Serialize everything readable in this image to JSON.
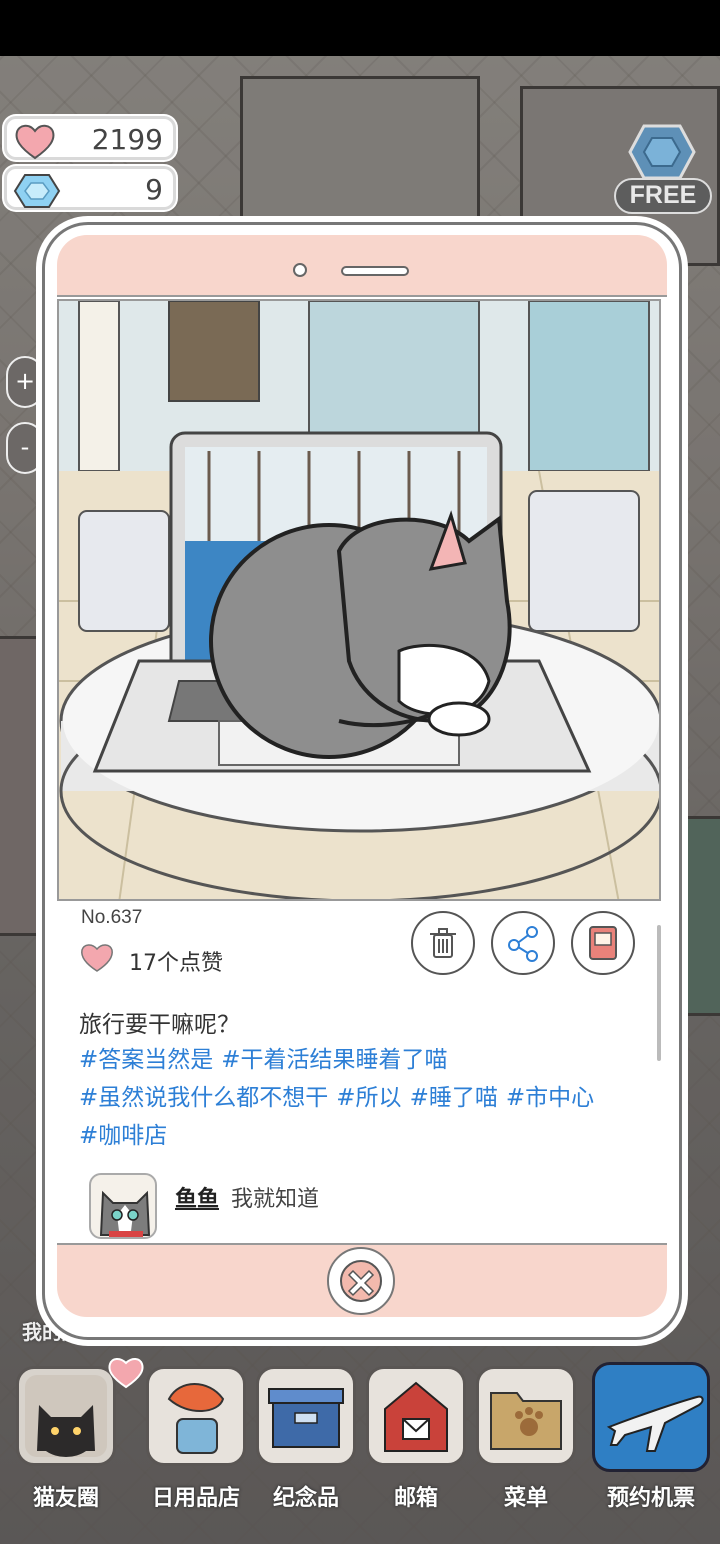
{
  "currency": {
    "hearts": "2199",
    "gems": "9"
  },
  "free_label": "FREE",
  "side_buttons": [
    "+",
    "-"
  ],
  "side_label": "我的房",
  "post": {
    "number": "No.637",
    "likes": "17个点赞",
    "caption": "旅行要干嘛呢？",
    "tags": [
      "#答案当然是",
      "#干着活结果睡着了喵",
      "#虽然说我什么都不想干",
      "#所以",
      "#睡了喵",
      "#市中心",
      "#咖啡店"
    ],
    "actions": [
      "trash-icon",
      "share-icon",
      "album-icon"
    ],
    "comment": {
      "name": "鱼鱼",
      "text": "我就知道"
    }
  },
  "dock": [
    {
      "label": "猫友圈",
      "icon": "cat-friends-icon"
    },
    {
      "label": "日用品店",
      "icon": "goods-store-icon"
    },
    {
      "label": "纪念品",
      "icon": "souvenir-box-icon"
    },
    {
      "label": "邮箱",
      "icon": "mailbox-icon"
    },
    {
      "label": "菜单",
      "icon": "menu-folder-icon"
    },
    {
      "label": "预约机票",
      "icon": "airplane-icon"
    }
  ],
  "colors": {
    "accent_pink": "#f8d6cc",
    "tag_blue": "#2d7fd6",
    "heart": "#f3a7ae"
  }
}
